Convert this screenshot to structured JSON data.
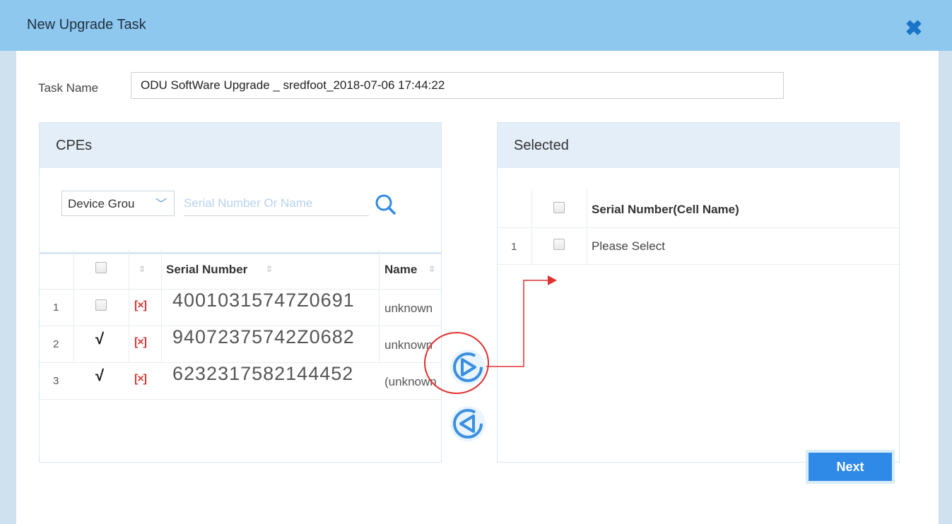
{
  "dialog": {
    "title": "New Upgrade Task",
    "close_icon": "close-icon"
  },
  "task": {
    "label": "Task Name",
    "value": "ODU SoftWare Upgrade _ sredfoot_2018-07-06 17:44:22"
  },
  "cpes": {
    "heading": "CPEs",
    "group_select": "Device Grou",
    "search_placeholder": "Serial Number Or Name",
    "columns": {
      "serial": "Serial Number",
      "name": "Name"
    },
    "remove_icon_text": "[×]",
    "rows": [
      {
        "num": "1",
        "checked": false,
        "serial": "40010315747Z0691",
        "name": "unknown"
      },
      {
        "num": "2",
        "checked": true,
        "serial": "94072375742Z0682",
        "name": "unknown"
      },
      {
        "num": "3",
        "checked": true,
        "serial": "6232317582144452",
        "name": "(unknown"
      }
    ]
  },
  "selected": {
    "heading": "Selected",
    "column": "Serial Number(Cell Name)",
    "rows": [
      {
        "num": "1",
        "text": "Please Select"
      }
    ]
  },
  "check_mark": "√",
  "actions": {
    "next": "Next"
  },
  "colors": {
    "accent": "#2f89e6",
    "titlebar": "#8ec8ee",
    "highlight": "#e03030"
  }
}
